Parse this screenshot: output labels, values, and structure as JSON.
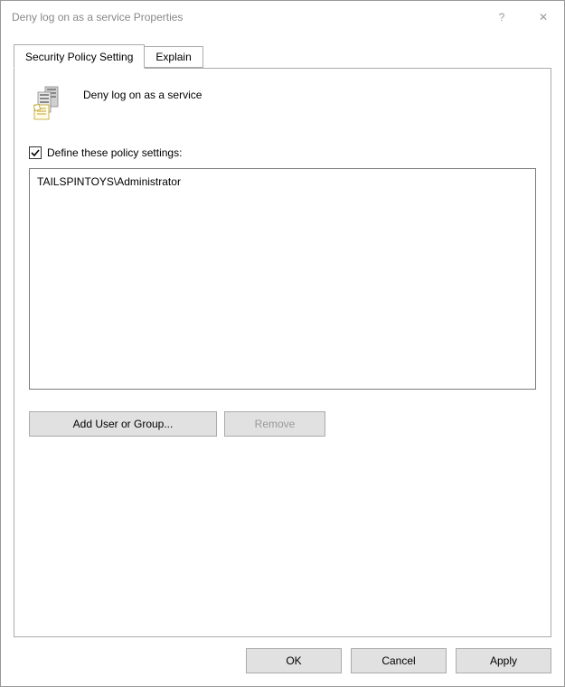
{
  "window": {
    "title": "Deny log on as a service Properties",
    "help_glyph": "?",
    "close_glyph": "✕"
  },
  "tabs": {
    "security": "Security Policy Setting",
    "explain": "Explain"
  },
  "policy": {
    "name": "Deny log on as a service",
    "checkbox_label": "Define these policy settings:",
    "checked": true
  },
  "list": {
    "items": [
      "TAILSPINTOYS\\Administrator"
    ]
  },
  "buttons": {
    "add": "Add User or Group...",
    "remove": "Remove",
    "ok": "OK",
    "cancel": "Cancel",
    "apply": "Apply"
  }
}
